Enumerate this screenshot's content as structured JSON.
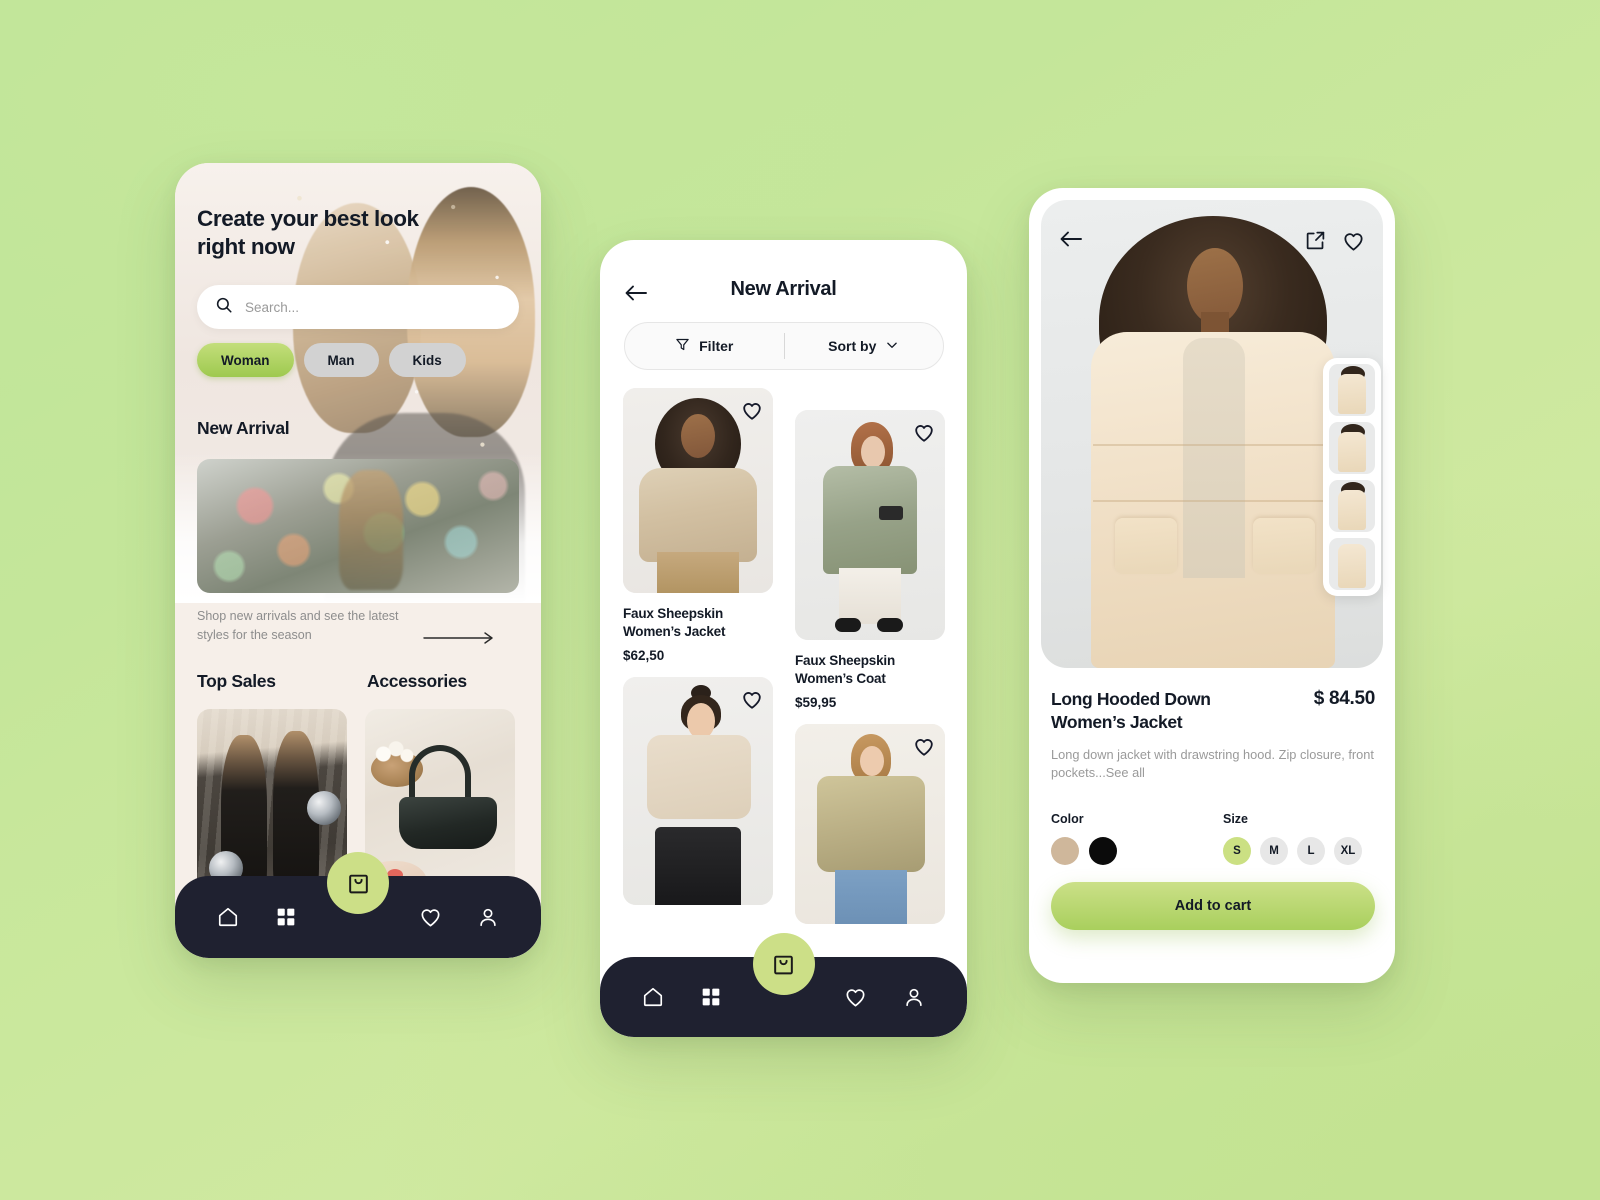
{
  "theme": {
    "accent_green": "#a9cf5d",
    "chip_green": "#b6d46a",
    "nav_dark": "#1f2130",
    "text_dark": "#131a26",
    "muted": "#9a9a9a"
  },
  "phone1": {
    "hero_title": "Create your best look right now",
    "search": {
      "placeholder": "Search...",
      "icon": "search-icon"
    },
    "categories": [
      {
        "label": "Woman",
        "active": true
      },
      {
        "label": "Man",
        "active": false
      },
      {
        "label": "Kids",
        "active": false
      }
    ],
    "new_arrival_heading": "New Arrival",
    "banner_caption": "Shop new arrivals and see the latest styles for the season",
    "banner_arrow_icon": "arrow-right-icon",
    "sections": [
      {
        "title": "Top Sales"
      },
      {
        "title": "Accessories"
      }
    ],
    "nav": [
      {
        "name": "home",
        "icon": "home-icon"
      },
      {
        "name": "grid",
        "icon": "grid-icon"
      },
      {
        "name": "cart",
        "icon": "shopping-bag-icon"
      },
      {
        "name": "favorites",
        "icon": "heart-icon"
      },
      {
        "name": "profile",
        "icon": "user-icon"
      }
    ]
  },
  "phone2": {
    "back_icon": "arrow-left-icon",
    "title": "New Arrival",
    "filter_label": "Filter",
    "filter_icon": "funnel-icon",
    "sort_label": "Sort by",
    "sort_icon": "chevron-down-icon",
    "products": [
      {
        "name": "Faux Sheepskin Women’s Jacket",
        "price": "$62,50",
        "favorite_icon": "heart-icon"
      },
      {
        "name": "Faux Sheepskin Women’s Coat",
        "price": "$59,95",
        "favorite_icon": "heart-icon"
      },
      {
        "name": "",
        "price": "",
        "favorite_icon": "heart-icon"
      },
      {
        "name": "",
        "price": "",
        "favorite_icon": "heart-icon"
      }
    ],
    "nav": [
      {
        "name": "home",
        "icon": "home-icon"
      },
      {
        "name": "grid",
        "icon": "grid-icon"
      },
      {
        "name": "cart",
        "icon": "shopping-bag-icon"
      },
      {
        "name": "favorites",
        "icon": "heart-icon"
      },
      {
        "name": "profile",
        "icon": "user-icon"
      }
    ]
  },
  "phone3": {
    "back_icon": "arrow-left-icon",
    "share_icon": "share-external-icon",
    "favorite_icon": "heart-icon",
    "product_name": "Long Hooded Down Women’s Jacket",
    "price": "$ 84.50",
    "description": "Long down jacket with drawstring hood. Zip closure, front pockets...See all",
    "color_label": "Color",
    "colors": [
      {
        "name": "beige",
        "hex": "#cfb79b"
      },
      {
        "name": "black",
        "hex": "#0b0b0b"
      }
    ],
    "size_label": "Size",
    "sizes": [
      {
        "label": "S",
        "active": true
      },
      {
        "label": "M",
        "active": false
      },
      {
        "label": "L",
        "active": false
      },
      {
        "label": "XL",
        "active": false
      }
    ],
    "add_to_cart_label": "Add to cart",
    "thumbnails": 4
  }
}
